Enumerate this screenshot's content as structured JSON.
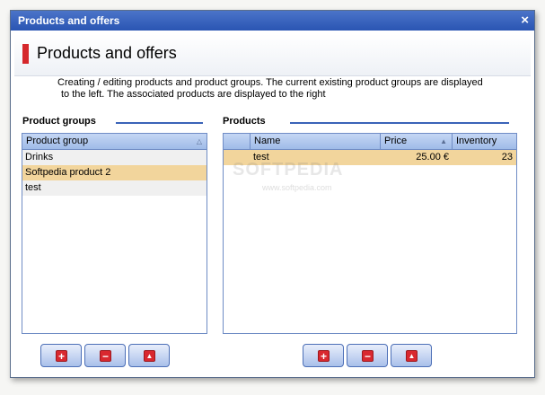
{
  "window": {
    "title": "Products and offers",
    "close_glyph": "×"
  },
  "header": {
    "title": "Products and offers"
  },
  "description": {
    "line1": "Creating / editing products and product groups. The current existing product groups are displayed",
    "line2": "to the left. The associated products are displayed to the right"
  },
  "groups": {
    "section_title": "Product groups",
    "column": "Product group",
    "rows": [
      "Drinks",
      "Softpedia product 2",
      "test"
    ],
    "selected_index": 1
  },
  "products": {
    "section_title": "Products",
    "columns": {
      "name": "Name",
      "price": "Price",
      "inventory": "Inventory"
    },
    "rows": [
      {
        "name": "test",
        "price": "25.00 €",
        "inventory": "23"
      }
    ]
  },
  "buttons": {
    "add_glyph": "+",
    "remove_glyph": "−",
    "up_glyph": "▲"
  },
  "icons": {
    "add": "plus-icon",
    "remove": "minus-icon",
    "up": "arrow-up-icon",
    "accent": "#d5272b"
  },
  "watermark": {
    "text": "SOFTPEDIA",
    "url": "www.softpedia.com"
  }
}
